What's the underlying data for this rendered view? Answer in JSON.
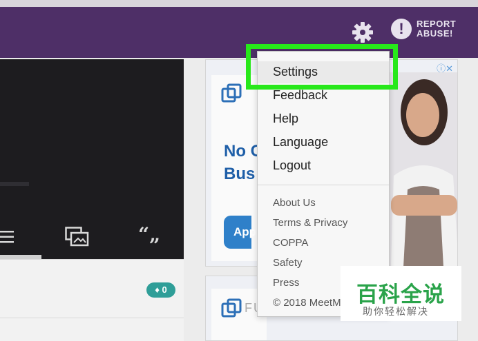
{
  "header": {
    "report_label": "REPORT ABUSE!",
    "report_line1": "REPORT",
    "report_line2": "ABUSE!",
    "report_symbol": "!"
  },
  "left_panel": {
    "quote_icon_label": "“„",
    "badge_count": "0"
  },
  "ad": {
    "headline_line1": "No C",
    "headline_line2": "Bus",
    "button_label": "App",
    "second_ad_text": "FU",
    "info_icons": "ⓘ✕"
  },
  "menu": {
    "main_items": [
      "Settings",
      "Feedback",
      "Help",
      "Language",
      "Logout"
    ],
    "secondary_items": [
      "About Us",
      "Terms & Privacy",
      "COPPA",
      "Safety",
      "Press",
      "© 2018 MeetM"
    ]
  },
  "watermark": {
    "title": "百科全说",
    "subtitle": "助你轻松解决"
  },
  "colors": {
    "header": "#4e2f67",
    "highlight": "#27e81a",
    "badge": "#2f9e98",
    "ad_headline": "#1f5fa8",
    "watermark_title": "#2aa34a"
  },
  "icons": [
    "gear-icon",
    "alert-icon",
    "list-icon",
    "image-gallery-icon",
    "quote-icon",
    "diamond-icon",
    "ad-logo-icon"
  ]
}
